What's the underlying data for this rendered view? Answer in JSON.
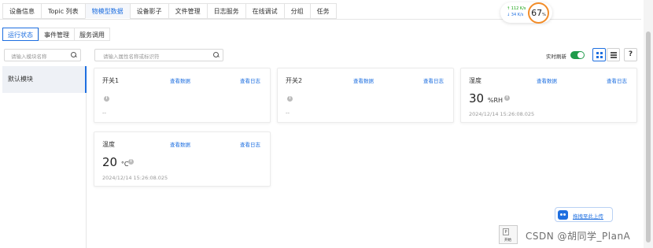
{
  "top_tabs": [
    "设备信息",
    "Topic 列表",
    "物模型数据",
    "设备影子",
    "文件管理",
    "日志服务",
    "在线调试",
    "分组",
    "任务"
  ],
  "top_tab_active_index": 2,
  "perf_widget": {
    "upload_speed": "↑ 112 K/s",
    "download_speed": "↓ 34 K/s",
    "percent": "67",
    "percent_unit": "%"
  },
  "sub_tabs": [
    "运行状态",
    "事件管理",
    "服务调用"
  ],
  "sub_tab_active_index": 0,
  "module_search": {
    "placeholder": "请输入模块名称"
  },
  "modules": [
    {
      "label": "默认模块"
    }
  ],
  "property_search": {
    "placeholder": "请输入属性名称或标识符"
  },
  "toolbar": {
    "realtime_refresh_label": "实时刷新",
    "realtime_refresh_on": true,
    "help_label": "?"
  },
  "cards": [
    {
      "name": "开关1",
      "view_data": "查看数据",
      "view_log": "查看日志",
      "value": "",
      "unit": "",
      "empty": "--",
      "time": ""
    },
    {
      "name": "开关2",
      "view_data": "查看数据",
      "view_log": "查看日志",
      "value": "",
      "unit": "",
      "empty": "--",
      "time": ""
    },
    {
      "name": "湿度",
      "view_data": "查看数据",
      "view_log": "查看日志",
      "value": "30",
      "unit": "%RH",
      "empty": "",
      "time": "2024/12/14 15:26:08.025"
    },
    {
      "name": "温度",
      "view_data": "查看数据",
      "view_log": "查看日志",
      "value": "20",
      "unit": "°C",
      "empty": "",
      "time": "2024/12/14 15:26:08.025"
    }
  ],
  "upload": {
    "label": "拖拽至此上传"
  },
  "taskbar_thumb": {
    "label": "开始",
    "icon_char": "P"
  },
  "watermark": "CSDN @胡同学_PlanA",
  "colors": {
    "accent": "#1e6fe0",
    "toggle_on": "#1f9b4a",
    "ring": "#f28c28"
  }
}
